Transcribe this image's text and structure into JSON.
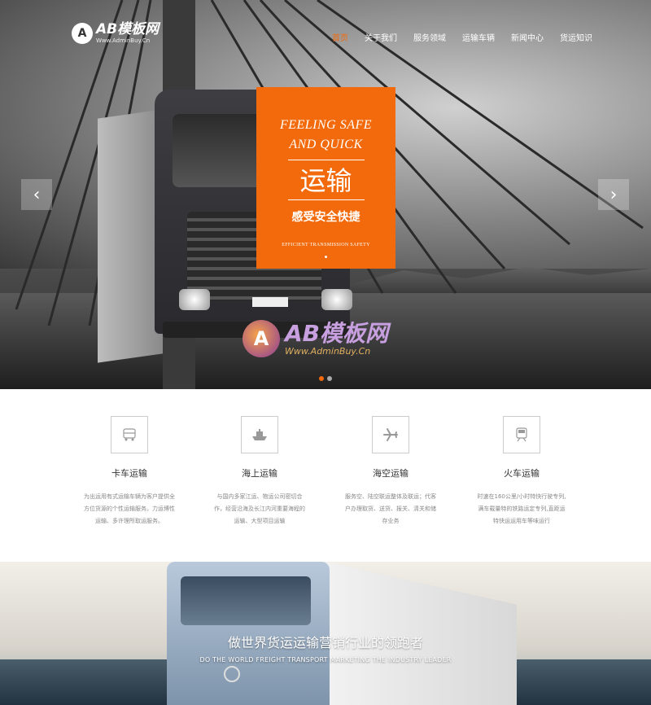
{
  "brand": {
    "logo_mark": "A",
    "name": "AB模板网",
    "sub": "Www.AdminBuy.Cn"
  },
  "nav": [
    {
      "label": "首页",
      "active": true
    },
    {
      "label": "关于我们",
      "active": false
    },
    {
      "label": "服务领域",
      "active": false
    },
    {
      "label": "运输车辆",
      "active": false
    },
    {
      "label": "新闻中心",
      "active": false
    },
    {
      "label": "货运知识",
      "active": false
    }
  ],
  "hero": {
    "en_line1": "FEELING SAFE",
    "en_line2": "AND QUICK",
    "cn_title": "运输",
    "cn_sub": "感受安全快捷",
    "tiny": "EFFICIENT TRANSMISSION SAFETY",
    "prev_icon": "chevron-left-icon",
    "next_icon": "chevron-right-icon",
    "prev_glyph": "‹",
    "next_glyph": "›",
    "accent": "#f26a0b",
    "slides": 2,
    "active_slide": 1
  },
  "watermark": {
    "logo": "A",
    "text": "AB模板网",
    "url": "Www.AdminBuy.Cn"
  },
  "services": [
    {
      "icon": "bus-icon",
      "title": "卡车运输",
      "desc": "为出运用有式运输车辆为客户提供全方位货源的个性运输服务。力运博性运输、多许理所取运服务。"
    },
    {
      "icon": "ship-icon",
      "title": "海上运输",
      "desc": "与国内多家江运、物运公司密切合作，经营沿海及长江内河重要海程的运输、大型项目运输"
    },
    {
      "icon": "airplane-icon",
      "title": "海空运输",
      "desc": "服务空、陆空联运整体及联运；代客户办理取货、送货、报关、清关和储存业务"
    },
    {
      "icon": "train-icon",
      "title": "火车运输",
      "desc": "时速在160公里/小时特快行驶专列,满车载量特的铁路运定专列,直距运特快运运用车等味运行"
    }
  ],
  "banner": {
    "title": "做世界货运运输营销行业的领跑者",
    "subtitle": "DO THE WORLD FREIGHT TRANSPORT MARKETING THE INDUSTRY LEADER"
  }
}
